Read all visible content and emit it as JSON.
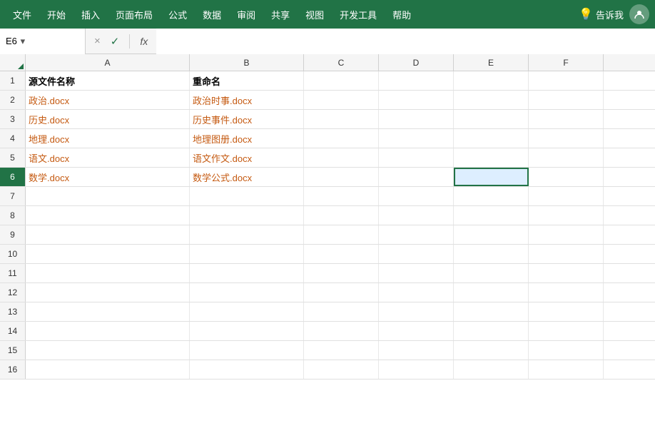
{
  "menuBar": {
    "items": [
      "文件",
      "开始",
      "插入",
      "页面布局",
      "公式",
      "数据",
      "审阅",
      "共享",
      "视图",
      "开发工具",
      "帮助"
    ],
    "tellMe": "告诉我",
    "bgColor": "#217346"
  },
  "formulaBar": {
    "cellRef": "E6",
    "cancelLabel": "×",
    "confirmLabel": "✓",
    "fxLabel": "fx",
    "dropdownArrow": "▾"
  },
  "columns": {
    "headers": [
      "A",
      "B",
      "C",
      "D",
      "E",
      "F"
    ]
  },
  "rows": [
    {
      "num": 1,
      "cells": [
        "源文件名称",
        "重命名",
        "",
        "",
        "",
        ""
      ],
      "style": [
        "header",
        "header",
        "",
        "",
        "",
        ""
      ]
    },
    {
      "num": 2,
      "cells": [
        "政治.docx",
        "政治时事.docx",
        "",
        "",
        "",
        ""
      ],
      "style": [
        "orange",
        "orange",
        "",
        "",
        "",
        ""
      ]
    },
    {
      "num": 3,
      "cells": [
        "历史.docx",
        "历史事件.docx",
        "",
        "",
        "",
        ""
      ],
      "style": [
        "orange",
        "orange",
        "",
        "",
        "",
        ""
      ]
    },
    {
      "num": 4,
      "cells": [
        "地理.docx",
        "地理图册.docx",
        "",
        "",
        "",
        ""
      ],
      "style": [
        "orange",
        "orange",
        "",
        "",
        "",
        ""
      ]
    },
    {
      "num": 5,
      "cells": [
        "语文.docx",
        "语文作文.docx",
        "",
        "",
        "",
        ""
      ],
      "style": [
        "orange",
        "orange",
        "",
        "",
        "",
        ""
      ]
    },
    {
      "num": 6,
      "cells": [
        "数学.docx",
        "数学公式.docx",
        "",
        "",
        "",
        ""
      ],
      "style": [
        "orange",
        "orange",
        "",
        "",
        "",
        ""
      ],
      "selected": true
    },
    {
      "num": 7,
      "cells": [
        "",
        "",
        "",
        "",
        "",
        ""
      ],
      "style": [
        "",
        "",
        "",
        "",
        "",
        ""
      ]
    },
    {
      "num": 8,
      "cells": [
        "",
        "",
        "",
        "",
        "",
        ""
      ],
      "style": [
        "",
        "",
        "",
        "",
        "",
        ""
      ]
    },
    {
      "num": 9,
      "cells": [
        "",
        "",
        "",
        "",
        "",
        ""
      ],
      "style": [
        "",
        "",
        "",
        "",
        "",
        ""
      ]
    },
    {
      "num": 10,
      "cells": [
        "",
        "",
        "",
        "",
        "",
        ""
      ],
      "style": [
        "",
        "",
        "",
        "",
        "",
        ""
      ]
    },
    {
      "num": 11,
      "cells": [
        "",
        "",
        "",
        "",
        "",
        ""
      ],
      "style": [
        "",
        "",
        "",
        "",
        "",
        ""
      ]
    },
    {
      "num": 12,
      "cells": [
        "",
        "",
        "",
        "",
        "",
        ""
      ],
      "style": [
        "",
        "",
        "",
        "",
        "",
        ""
      ]
    },
    {
      "num": 13,
      "cells": [
        "",
        "",
        "",
        "",
        "",
        ""
      ],
      "style": [
        "",
        "",
        "",
        "",
        "",
        ""
      ]
    },
    {
      "num": 14,
      "cells": [
        "",
        "",
        "",
        "",
        "",
        ""
      ],
      "style": [
        "",
        "",
        "",
        "",
        "",
        ""
      ]
    },
    {
      "num": 15,
      "cells": [
        "",
        "",
        "",
        "",
        "",
        ""
      ],
      "style": [
        "",
        "",
        "",
        "",
        "",
        ""
      ]
    },
    {
      "num": 16,
      "cells": [
        "",
        "",
        "",
        "",
        "",
        ""
      ],
      "style": [
        "",
        "",
        "",
        "",
        "",
        ""
      ]
    }
  ]
}
